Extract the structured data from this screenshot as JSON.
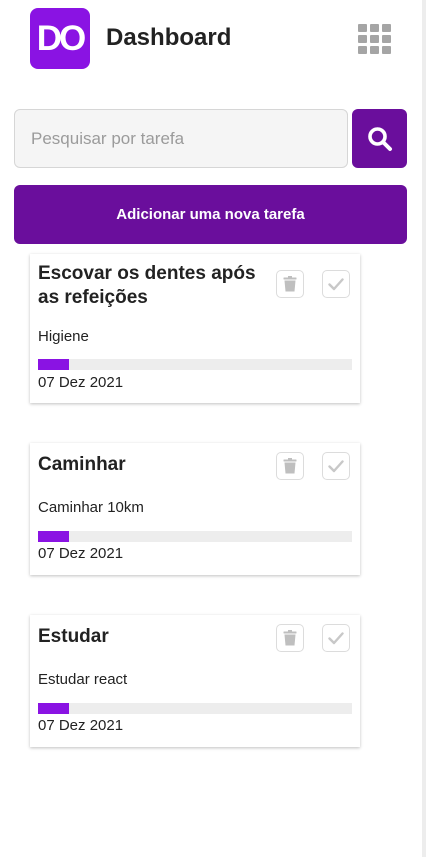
{
  "header": {
    "logo_text": "DO",
    "title": "Dashboard",
    "menu_icon": "apps-grid-icon"
  },
  "search": {
    "placeholder": "Pesquisar por tarefa",
    "value": "",
    "button_icon": "search-icon"
  },
  "add_task": {
    "label": "Adicionar uma nova tarefa"
  },
  "colors": {
    "brand": "#8a13e3",
    "button": "#6a0e9c",
    "track": "#ededed"
  },
  "tasks": [
    {
      "title": "Escovar os dentes após as refeições",
      "description": "Higiene",
      "date": "07 Dez 2021",
      "progress": 0.1,
      "delete_icon": "trash-icon",
      "complete_icon": "check-icon"
    },
    {
      "title": "Caminhar",
      "description": "Caminhar 10km",
      "date": "07 Dez 2021",
      "progress": 0.1,
      "delete_icon": "trash-icon",
      "complete_icon": "check-icon"
    },
    {
      "title": "Estudar",
      "description": "Estudar react",
      "date": "07 Dez 2021",
      "progress": 0.1,
      "delete_icon": "trash-icon",
      "complete_icon": "check-icon"
    }
  ]
}
